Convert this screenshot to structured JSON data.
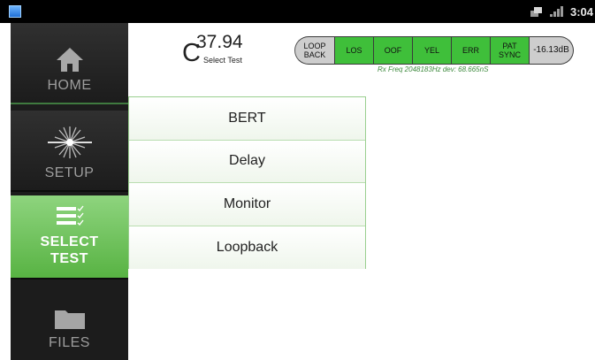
{
  "status_bar": {
    "clock": "3:04",
    "icons": [
      "app-icon",
      "notification-icon",
      "signal-icon"
    ]
  },
  "sidebar": {
    "items": [
      {
        "label": "HOME",
        "icon": "home-icon"
      },
      {
        "label": "SETUP",
        "icon": "laser-icon"
      },
      {
        "label_line1": "SELECT",
        "label_line2": "TEST",
        "icon": "checklist-icon",
        "selected": true
      },
      {
        "label": "FILES",
        "icon": "folder-icon"
      }
    ]
  },
  "header": {
    "reading_prefix": "C",
    "reading_value": "37.94",
    "reading_caption": "Select Test",
    "alarms": [
      {
        "line1": "LOOP",
        "line2": "BACK"
      },
      {
        "label": "LOS"
      },
      {
        "label": "OOF"
      },
      {
        "label": "YEL"
      },
      {
        "label": "ERR"
      },
      {
        "label": "PAT SYNC"
      },
      {
        "label": "-16.13dB"
      }
    ],
    "rx_info": "Rx Freq 2048183Hz dev: 68.665nS"
  },
  "menu": {
    "items": [
      "BERT",
      "Delay",
      "Monitor",
      "Loopback"
    ]
  },
  "colors": {
    "accent_green": "#58b343",
    "alarm_green": "#3fbf3a",
    "alarm_grey": "#cdcdcd",
    "sidebar_bg": "#1c1c1c"
  }
}
